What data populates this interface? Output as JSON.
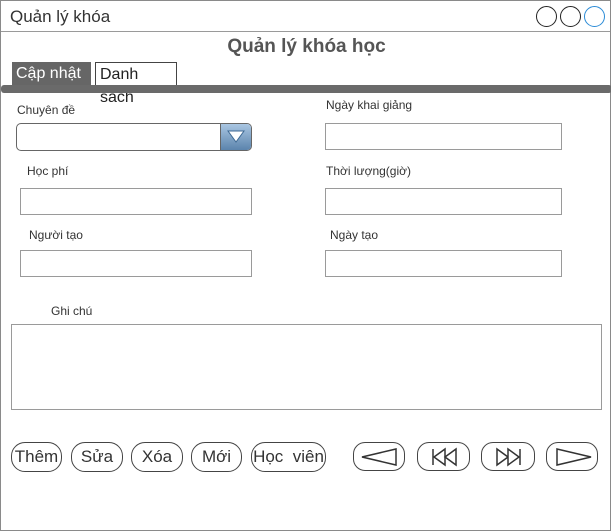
{
  "window": {
    "title": "Quản lý khóa"
  },
  "page": {
    "title": "Quản lý khóa học"
  },
  "tabs": [
    {
      "label": "Cập nhật",
      "active": true
    },
    {
      "label": "Danh sách",
      "active": false
    }
  ],
  "form": {
    "topic_label": "Chuyên đề",
    "topic_value": "",
    "start_date_label": "Ngày khai giảng",
    "start_date_value": "",
    "fee_label": "Học phí",
    "fee_value": "",
    "duration_label": "Thời lượng(giờ)",
    "duration_value": "",
    "creator_label": "Người tạo",
    "creator_value": "",
    "created_date_label": "Ngày tạo",
    "created_date_value": "",
    "notes_label": "Ghi chú",
    "notes_value": ""
  },
  "actions": {
    "add_label": "Thêm",
    "edit_label": "Sửa",
    "delete_label": "Xóa",
    "new_label": "Mới",
    "students_label": "Học  viên"
  },
  "navigation": {
    "first_icon": "first-record-icon",
    "prev_icon": "previous-record-icon",
    "next_icon": "next-record-icon",
    "last_icon": "last-record-icon"
  },
  "colors": {
    "tab_active_bg": "#666666",
    "accent_line": "#6a6a6a",
    "dropdown_gradient_top": "#a9c6e2",
    "dropdown_gradient_bottom": "#5b84ad"
  }
}
